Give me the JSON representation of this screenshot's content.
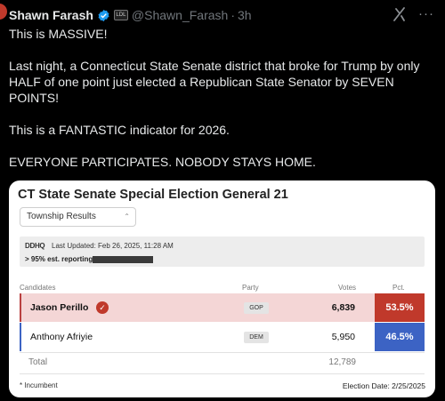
{
  "tweet": {
    "author_name": "Shawn Farash",
    "handle": "@Shawn_Farash",
    "separator": "·",
    "time": "3h",
    "affiliation_badge": "LDL",
    "icons": {
      "verified": "verified-badge-icon",
      "grok": "grok-icon",
      "more": "more-icon"
    },
    "paragraphs": [
      "This is MASSIVE!",
      "Last night, a Connecticut State Senate district that broke for Trump by only HALF of one point just elected a Republican State Senator by SEVEN POINTS!",
      "This is a FANTASTIC indicator for 2026.",
      "EVERYONE PARTICIPATES. NOBODY STAYS HOME."
    ]
  },
  "card": {
    "title": "CT State Senate Special Election General 21",
    "dropdown_value": "Township Results",
    "logo_text": "DDHQ",
    "last_updated": "Last Updated: Feb 26, 2025, 11:28 AM",
    "reporting": "> 95% est. reporting",
    "columns": {
      "candidates": "Candidates",
      "party": "Party",
      "votes": "Votes",
      "pct": "Pct."
    },
    "candidates": [
      {
        "name": "Jason Perillo",
        "party": "GOP",
        "votes": "6,839",
        "pct": "53.5%",
        "winner": true
      },
      {
        "name": "Anthony Afriyie",
        "party": "DEM",
        "votes": "5,950",
        "pct": "46.5%",
        "winner": false
      }
    ],
    "total_label": "Total",
    "total_votes": "12,789",
    "footnote": "* Incumbent",
    "election_date": "Election Date: 2/25/2025",
    "colors": {
      "gop": "#c0392b",
      "dem": "#3c63c4",
      "winner_row": "#f4d6d6"
    }
  }
}
